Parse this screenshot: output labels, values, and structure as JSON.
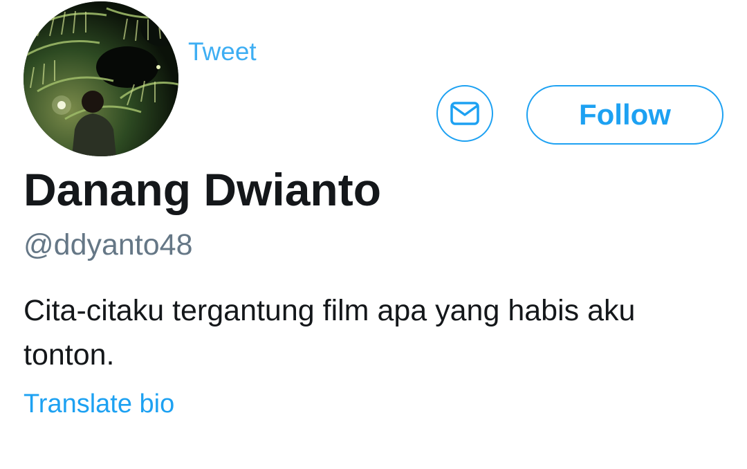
{
  "profile": {
    "display_name": "Danang Dwianto",
    "handle": "@ddyanto48",
    "bio": "Cita-citaku tergantung film apa yang habis aku tonton.",
    "translate_bio_label": "Translate bio",
    "tweet_label": "Tweet",
    "avatar_icon": "profile-photo"
  },
  "actions": {
    "message_icon": "envelope-icon",
    "follow_label": "Follow"
  },
  "colors": {
    "accent": "#1da1f2",
    "text_primary": "#14171a",
    "text_secondary": "#657786"
  }
}
